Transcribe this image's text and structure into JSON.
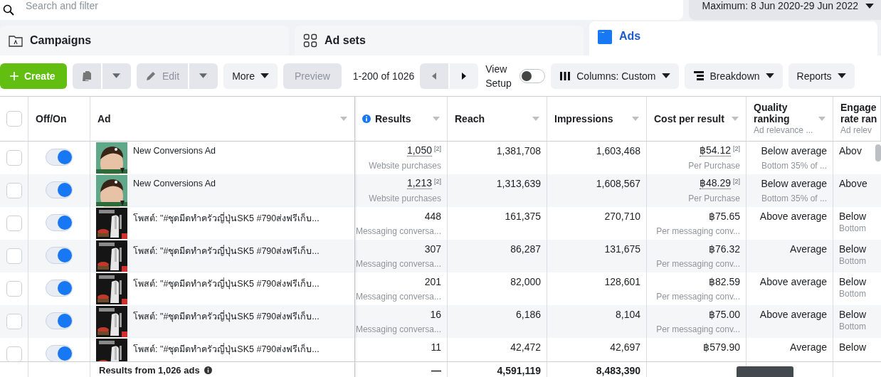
{
  "search": {
    "placeholder": "Search and filter"
  },
  "select_all": false,
  "date_range": "Maximum: 8 Jun 2020-29 Jun 2022",
  "tabs": [
    {
      "label": "Campaigns",
      "kind": "campaigns",
      "selected": false
    },
    {
      "label": "Ad sets",
      "kind": "adsets",
      "selected": false
    },
    {
      "label": "Ads",
      "kind": "ads",
      "selected": true
    }
  ],
  "toolbar": {
    "create": "Create",
    "edit": "Edit",
    "more": "More",
    "preview": "Preview",
    "pagination": "1-200 of 1026",
    "view_setup": "View Setup",
    "view_setup_on": false,
    "columns": "Columns: Custom",
    "breakdown": "Breakdown",
    "reports": "Reports"
  },
  "columns": [
    {
      "label": "Off/On",
      "kind": "toggle"
    },
    {
      "label": "Ad",
      "kind": "ad"
    },
    {
      "label": "Results",
      "kind": "num",
      "info": true
    },
    {
      "label": "Reach",
      "kind": "num"
    },
    {
      "label": "Impressions",
      "kind": "num"
    },
    {
      "label": "Cost per result",
      "kind": "num"
    },
    {
      "label": "Quality ranking",
      "kind": "rank",
      "note": "Ad relevance ..."
    },
    {
      "label": "Engage rate ran",
      "kind": "rank",
      "note": "Ad relev"
    }
  ],
  "rows": [
    {
      "checked": false,
      "on": true,
      "name": "New Conversions Ad",
      "results": "1,050",
      "results_ref": "[2]",
      "results_label": "Website purchases",
      "reach": "1,381,708",
      "impressions": "1,603,468",
      "cost": "฿54.12",
      "cost_ref": "[2]",
      "cost_label": "Per Purchase",
      "quality": "Below average",
      "quality_note": "Bottom 35% of ...",
      "engagement": "Abov"
    },
    {
      "checked": false,
      "on": true,
      "name": "New Conversions Ad",
      "results": "1,213",
      "results_ref": "[2]",
      "results_label": "Website purchases",
      "reach": "1,313,639",
      "impressions": "1,608,567",
      "cost": "฿48.29",
      "cost_ref": "[2]",
      "cost_label": "Per Purchase",
      "quality": "Below average",
      "quality_note": "Bottom 35% of ...",
      "engagement": "Above"
    },
    {
      "checked": false,
      "on": true,
      "name": "โพสต์: \"#ชุดมีดทำครัวญี่ปุ่นSK5 #790ส่งฟรีเก็บ...",
      "results": "448",
      "results_label": "Messaging conversa...",
      "reach": "161,375",
      "impressions": "270,710",
      "cost": "฿75.65",
      "cost_label": "Per messaging conv...",
      "quality": "Above average",
      "engagement": "Below",
      "engagement_note": "Bottom"
    },
    {
      "checked": false,
      "on": true,
      "name": "โพสต์: \"#ชุดมีดทำครัวญี่ปุ่นSK5 #790ส่งฟรีเก็บ...",
      "results": "307",
      "results_label": "Messaging conversa...",
      "reach": "86,287",
      "impressions": "131,675",
      "cost": "฿76.32",
      "cost_label": "Per messaging conv...",
      "quality": "Average",
      "engagement": "Below",
      "engagement_note": "Bottom"
    },
    {
      "checked": false,
      "on": true,
      "name": "โพสต์: \"#ชุดมีดทำครัวญี่ปุ่นSK5 #790ส่งฟรีเก็บ...",
      "results": "201",
      "results_label": "Messaging conversa...",
      "reach": "82,000",
      "impressions": "128,601",
      "cost": "฿82.59",
      "cost_label": "Per messaging conv...",
      "quality": "Above average",
      "engagement": "Below",
      "engagement_note": "Bottom"
    },
    {
      "checked": false,
      "on": true,
      "name": "โพสต์: \"#ชุดมีดทำครัวญี่ปุ่นSK5 #790ส่งฟรีเก็บ...",
      "results": "16",
      "results_label": "Messaging conversa...",
      "reach": "6,186",
      "impressions": "8,104",
      "cost": "฿75.00",
      "cost_label": "Per messaging conv...",
      "quality": "Above average",
      "engagement": "Below",
      "engagement_note": "Bottom"
    },
    {
      "checked": false,
      "on": true,
      "name": "โพสต์: \"#ชุดมีดทำครัวญี่ปุ่นSK5 #790ส่งฟรีเก็บ...",
      "results": "11",
      "reach": "42,472",
      "impressions": "42,697",
      "cost": "฿579.90",
      "quality": "Average",
      "engagement": "Below"
    }
  ],
  "footer": {
    "label": "Results from 1,026 ads",
    "results": "—",
    "reach": "4,591,119",
    "impressions": "8,483,390"
  }
}
